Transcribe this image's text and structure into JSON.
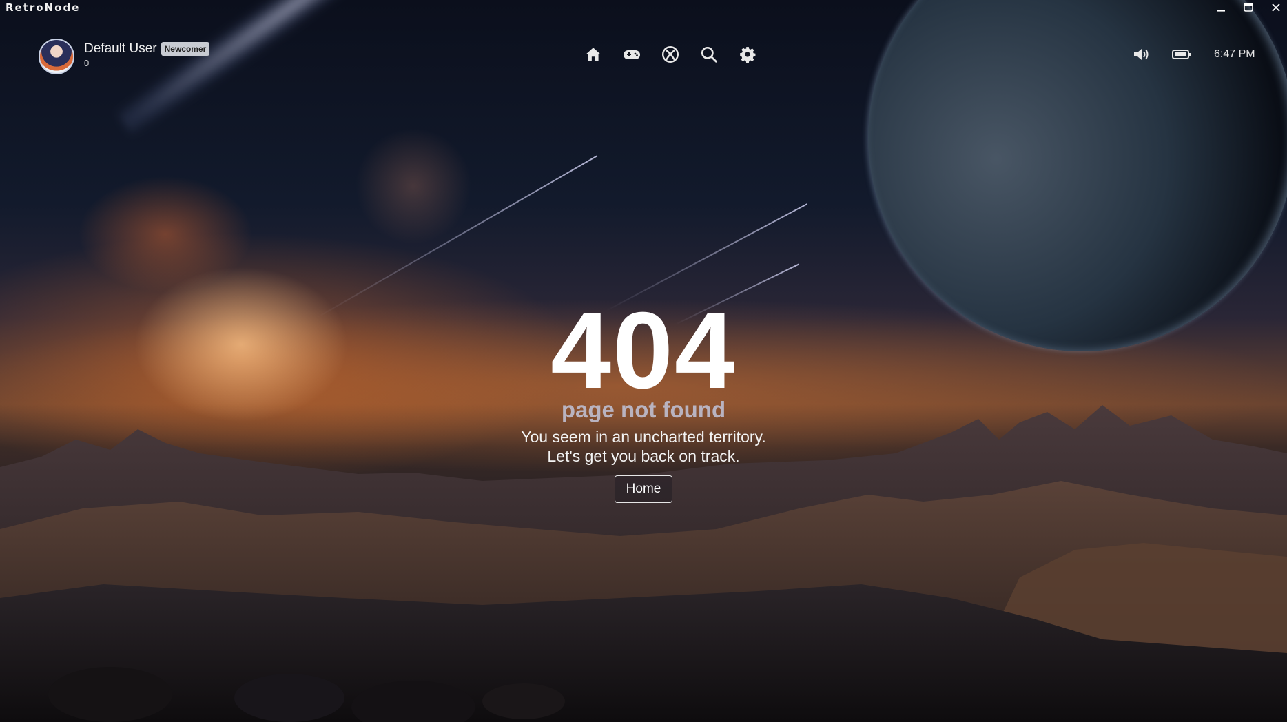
{
  "window": {
    "title": "RetroNode",
    "controls": [
      "minimize",
      "maximize",
      "close"
    ]
  },
  "user": {
    "name": "Default User",
    "badge": "Newcomer",
    "score": "0"
  },
  "nav": {
    "icons": [
      "home-icon",
      "gamepad-icon",
      "xbox-icon",
      "search-icon",
      "settings-gear-icon"
    ]
  },
  "status": {
    "icons": [
      "volume-icon",
      "battery-icon"
    ],
    "time": "6:47 PM"
  },
  "error": {
    "code": "404",
    "title": "page not found",
    "line1": "You seem in an uncharted territory.",
    "line2": "Let's get you back on track.",
    "button_label": "Home"
  },
  "colors": {
    "subtitle": "#b9b3c0",
    "badge_bg": "#c8cbd2"
  }
}
